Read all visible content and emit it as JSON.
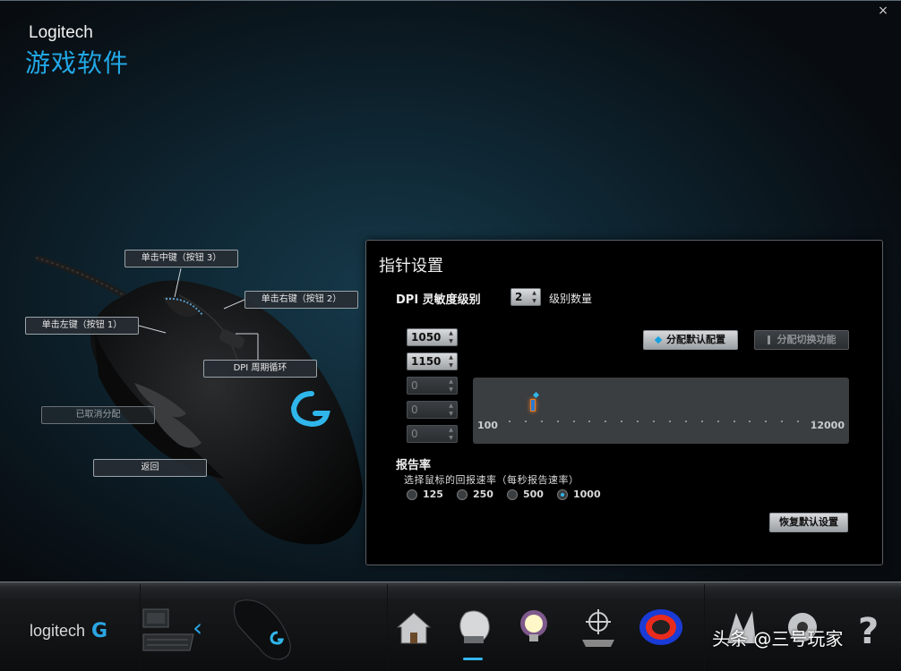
{
  "header": {
    "brand": "Logitech",
    "subtitle": "游戏软件",
    "close_icon": "×"
  },
  "mouse": {
    "callouts": {
      "middle": "单击中键（按钮 3）",
      "right": "单击右键（按钮 2）",
      "left": "单击左键（按钮 1）",
      "dpi_cycle": "DPI 周期循环",
      "unassigned": "已取消分配",
      "back": "返回"
    }
  },
  "panel": {
    "title": "指针设置",
    "dpi_label": "DPI 灵敏度级别",
    "level_count_value": "2",
    "level_count_label": "级别数量",
    "dpi_levels": [
      "1050",
      "1150",
      "0",
      "0",
      "0"
    ],
    "assign_default_label": "分配默认配置",
    "assign_shift_label": "分配切换功能",
    "slider": {
      "min_label": "100",
      "max_label": "12000",
      "min": 100,
      "max": 12000,
      "values": [
        1050,
        1150
      ]
    },
    "report_rate_title": "报告率",
    "report_rate_sub": "选择鼠标的回报速率（每秒报告速率）",
    "report_rates": [
      "125",
      "250",
      "500",
      "1000"
    ],
    "selected_rate": "1000",
    "restore_label": "恢复默认设置"
  },
  "bottom": {
    "logo_text": "logitech",
    "logo_mark": "G",
    "watermark": "头条 @三号玩家",
    "tools": [
      "home-icon",
      "mouse-settings-icon",
      "lighting-icon",
      "pointer-settings-icon",
      "heatmap-icon",
      "fight-icon",
      "settings-gear-icon",
      "help-icon"
    ]
  },
  "colors": {
    "accent": "#22a8e6",
    "orange": "#f07a1e"
  }
}
